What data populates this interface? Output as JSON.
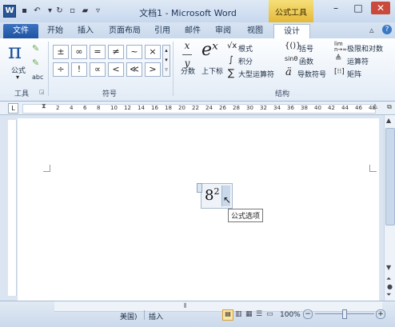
{
  "titlebar": {
    "doc_title": "文档1 - Microsoft Word",
    "context_group": "公式工具",
    "app_logo": "W",
    "qat": [
      "save-icon",
      "undo-icon",
      "redo-icon",
      "new-doc-icon",
      "open-icon",
      "customize-icon"
    ],
    "window_controls": [
      "minimize-icon",
      "maximize-icon",
      "close-icon"
    ]
  },
  "tabs": [
    "文件",
    "开始",
    "插入",
    "页面布局",
    "引用",
    "邮件",
    "审阅",
    "视图",
    "设计"
  ],
  "ribbon": {
    "tools_group": {
      "label": "工具",
      "formula_btn": "公式",
      "formula_glyph": "π",
      "abc_label": "abc"
    },
    "symbols_group": {
      "label": "符号",
      "row1": [
        "±",
        "∞",
        "=",
        "≠",
        "~",
        "×"
      ],
      "row2": [
        "÷",
        "!",
        "∝",
        "<",
        "≪",
        ">"
      ]
    },
    "structures_group": {
      "label": "结构",
      "fraction": "分数",
      "fraction_glyph": "x/y",
      "script": "上下标",
      "script_glyph": "eˣ",
      "radical": "根式",
      "integral": "积分",
      "large_operator": "大型运算符",
      "bracket": "括号",
      "function": "函数",
      "accent": "导数符号",
      "limit_log": "极限和对数",
      "operator": "运算符",
      "matrix": "矩阵"
    }
  },
  "ruler_ticks": [
    "2",
    "4",
    "6",
    "8",
    "10",
    "12",
    "14",
    "16",
    "18",
    "20",
    "22",
    "24",
    "26",
    "28",
    "30",
    "32",
    "34",
    "36",
    "38",
    "40",
    "42",
    "44",
    "46",
    "48"
  ],
  "equation": {
    "base": "8",
    "exponent": "2",
    "tooltip": "公式选项"
  },
  "statusbar": {
    "language": "美国)",
    "mode": "插入",
    "zoom": "100%",
    "zoom_minus": "−",
    "zoom_plus": "+"
  }
}
